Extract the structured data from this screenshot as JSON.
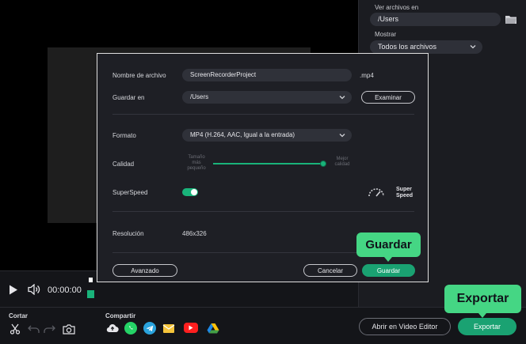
{
  "right_panel": {
    "view_files_label": "Ver archivos en",
    "view_files_value": "/Users",
    "show_label": "Mostrar",
    "show_value": "Todos los archivos"
  },
  "player": {
    "timecode": "00:00:00"
  },
  "bottom": {
    "cut_label": "Cortar",
    "share_label": "Compartir",
    "open_editor_label": "Abrir en Video Editor",
    "export_label": "Exportar"
  },
  "dialog": {
    "filename_label": "Nombre de archivo",
    "filename_value": "ScreenRecorderProject",
    "extension": ".mp4",
    "save_in_label": "Guardar en",
    "save_in_value": "/Users",
    "browse_label": "Examinar",
    "format_label": "Formato",
    "format_value": "MP4 (H.264, AAC, Igual a la entrada)",
    "quality_label": "Calidad",
    "quality_min_label": "Tamaño más pequeño",
    "quality_max_label": "Mejor calidad",
    "quality_level": 1.0,
    "superspeed_label": "SuperSpeed",
    "superspeed_on": true,
    "superspeed_brand_1": "Super",
    "superspeed_brand_2": "Speed",
    "resolution_label": "Resolución",
    "resolution_value": "486x326",
    "advanced_label": "Avanzado",
    "cancel_label": "Cancelar",
    "save_label": "Guardar"
  },
  "callouts": {
    "save": "Guardar",
    "export": "Exportar"
  },
  "colors": {
    "accent_green": "#1aa272",
    "callout_green": "#45d684",
    "panel_bg": "#1b1c21",
    "dialog_bg": "#1e1f25"
  }
}
